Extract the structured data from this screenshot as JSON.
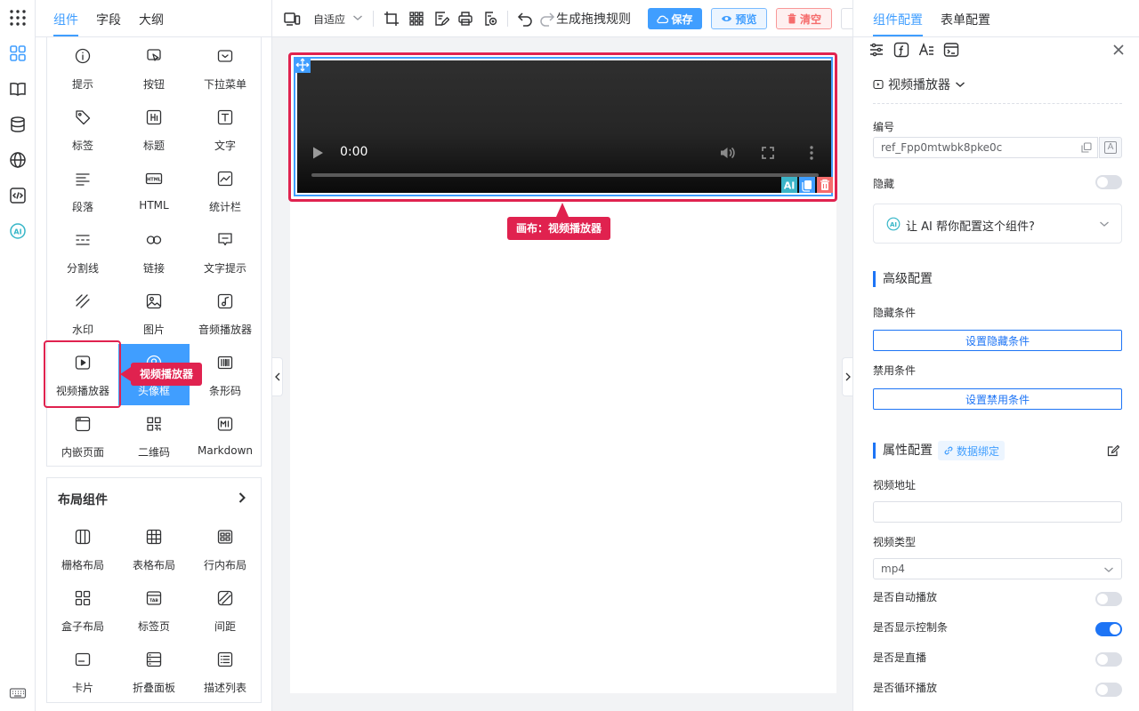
{
  "left_tabs": [
    "组件",
    "字段",
    "大纲"
  ],
  "basic_components": [
    {
      "label": "提示",
      "icon": "info-icon"
    },
    {
      "label": "按钮",
      "icon": "button-icon"
    },
    {
      "label": "下拉菜单",
      "icon": "dropdown-icon"
    },
    {
      "label": "标签",
      "icon": "tag-icon"
    },
    {
      "label": "标题",
      "icon": "heading-icon"
    },
    {
      "label": "文字",
      "icon": "text-icon"
    },
    {
      "label": "段落",
      "icon": "paragraph-icon"
    },
    {
      "label": "HTML",
      "icon": "html-icon"
    },
    {
      "label": "统计栏",
      "icon": "statistic-icon"
    },
    {
      "label": "分割线",
      "icon": "divider-icon"
    },
    {
      "label": "链接",
      "icon": "link-icon"
    },
    {
      "label": "文字提示",
      "icon": "tooltip-icon"
    },
    {
      "label": "水印",
      "icon": "watermark-icon"
    },
    {
      "label": "图片",
      "icon": "image-icon"
    },
    {
      "label": "音频播放器",
      "icon": "audio-icon"
    },
    {
      "label": "视频播放器",
      "icon": "video-icon"
    },
    {
      "label": "头像框",
      "icon": "avatar-icon"
    },
    {
      "label": "条形码",
      "icon": "barcode-icon"
    },
    {
      "label": "内嵌页面",
      "icon": "iframe-icon"
    },
    {
      "label": "二维码",
      "icon": "qrcode-icon"
    },
    {
      "label": "Markdown",
      "icon": "markdown-icon"
    }
  ],
  "layout_section_title": "布局组件",
  "layout_components": [
    {
      "label": "栅格布局",
      "icon": "grid-layout-icon"
    },
    {
      "label": "表格布局",
      "icon": "table-layout-icon"
    },
    {
      "label": "行内布局",
      "icon": "inline-layout-icon"
    },
    {
      "label": "盒子布局",
      "icon": "box-layout-icon"
    },
    {
      "label": "标签页",
      "icon": "tabs-icon"
    },
    {
      "label": "间距",
      "icon": "spacing-icon"
    },
    {
      "label": "卡片",
      "icon": "card-icon"
    },
    {
      "label": "折叠面板",
      "icon": "collapse-icon"
    },
    {
      "label": "描述列表",
      "icon": "descriptions-icon"
    }
  ],
  "left_callout": "视频播放器",
  "toolbar": {
    "device_label": "自适应",
    "generate_rule": "生成拖拽规则",
    "save": "保存",
    "preview": "预览",
    "clear": "清空"
  },
  "video": {
    "time": "0:00"
  },
  "canvas_callout": "画布：视频播放器",
  "right_tabs": [
    "组件配置",
    "表单配置"
  ],
  "component_type": "视频播放器",
  "fields": {
    "id_label": "编号",
    "id_value": "ref_Fpp0mtwbk8pke0c",
    "id_badge": "A",
    "hidden_label": "隐藏",
    "ai_prompt": "让 AI 帮你配置这个组件?",
    "advanced_title": "高级配置",
    "hide_cond_label": "隐藏条件",
    "hide_cond_btn": "设置隐藏条件",
    "disable_cond_label": "禁用条件",
    "disable_cond_btn": "设置禁用条件",
    "props_title": "属性配置",
    "data_bind": "数据绑定",
    "video_url_label": "视频地址",
    "video_url_value": "",
    "video_type_label": "视频类型",
    "video_type_value": "mp4",
    "autoplay_label": "是否自动播放",
    "autoplay": false,
    "controls_label": "是否显示控制条",
    "controls": true,
    "live_label": "是否是直播",
    "live": false,
    "loop_label": "是否循环播放",
    "loop": false
  },
  "colors": {
    "primary": "#409eff",
    "accent": "#1d74f5",
    "danger": "#e0224f",
    "selected_cell": "#409eff"
  }
}
